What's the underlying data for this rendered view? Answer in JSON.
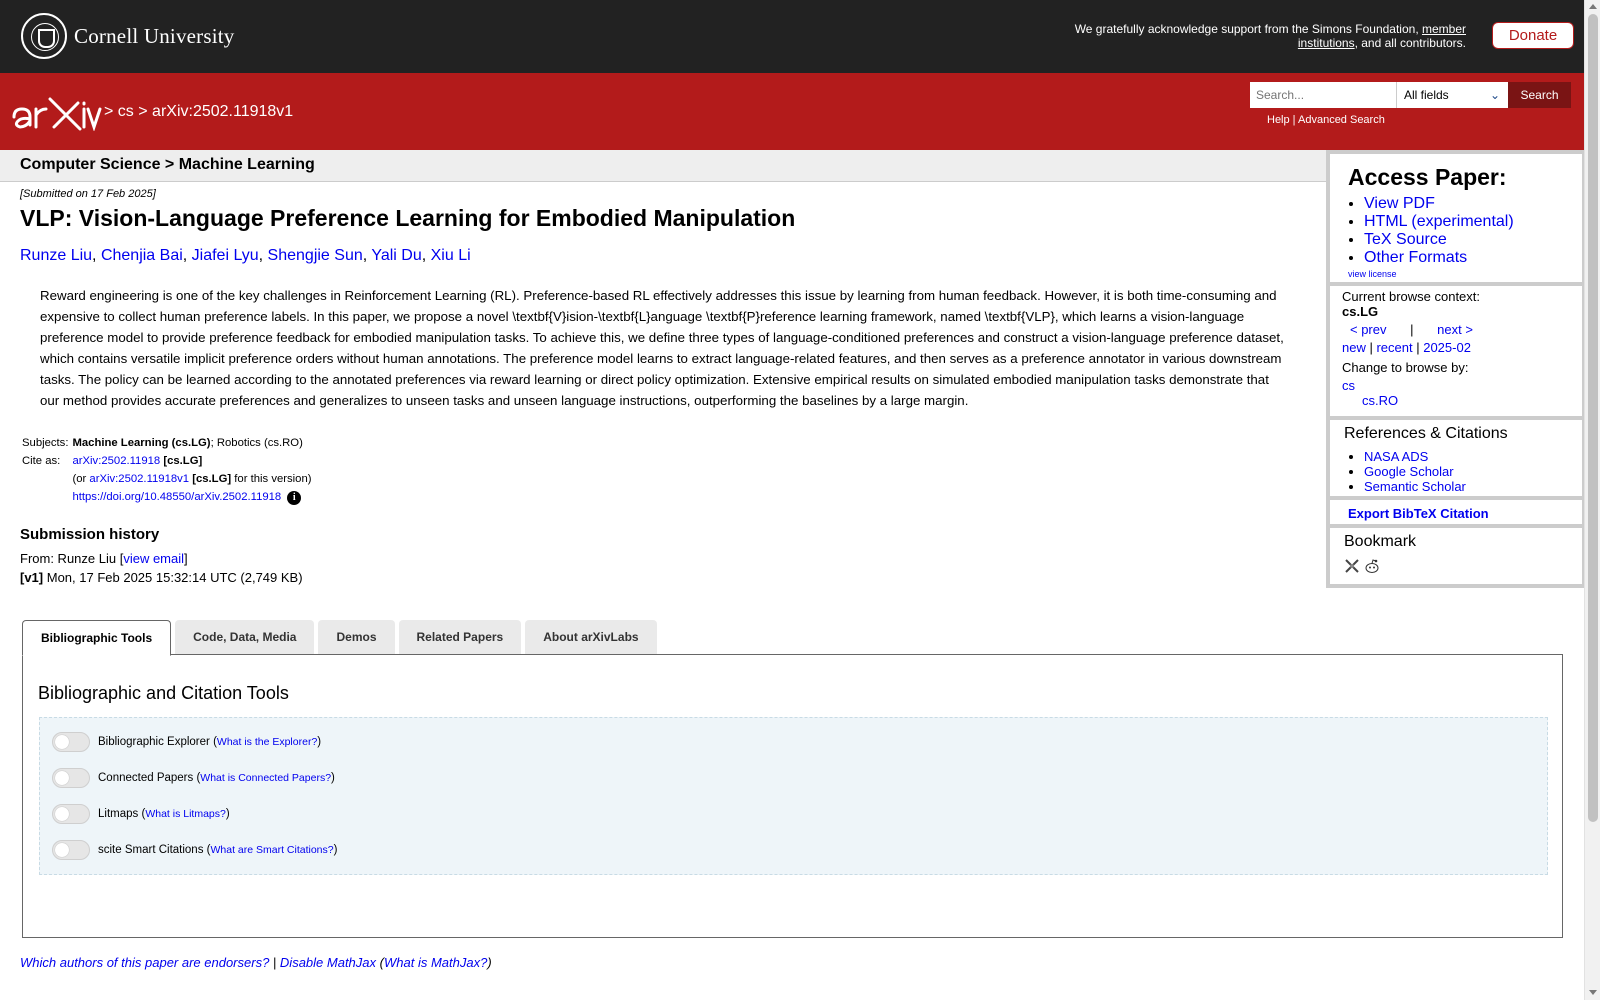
{
  "top": {
    "university": "Cornell University",
    "ack_text": "We gratefully acknowledge support from the Simons Foundation, ",
    "ack_link": "member institutions",
    "ack_tail": ", and all contributors.",
    "donate": "Donate"
  },
  "header": {
    "crumb_sep1": ">",
    "crumb_cs": "cs",
    "crumb_sep2": ">",
    "crumb_id": "arXiv:2502.11918v1",
    "search_placeholder": "Search...",
    "field_select": "All fields",
    "search_button": "Search",
    "help": "Help",
    "advanced": "Advanced Search"
  },
  "paper": {
    "subject_bar": "Computer Science > Machine Learning",
    "submitted": "[Submitted on 17 Feb 2025]",
    "title": "VLP: Vision-Language Preference Learning for Embodied Manipulation",
    "authors": [
      "Runze Liu",
      "Chenjia Bai",
      "Jiafei Lyu",
      "Shengjie Sun",
      "Yali Du",
      "Xiu Li"
    ],
    "abstract": "Reward engineering is one of the key challenges in Reinforcement Learning (RL). Preference-based RL effectively addresses this issue by learning from human feedback. However, it is both time-consuming and expensive to collect human preference labels. In this paper, we propose a novel \\textbf{V}ision-\\textbf{L}anguage \\textbf{P}reference learning framework, named \\textbf{VLP}, which learns a vision-language preference model to provide preference feedback for embodied manipulation tasks. To achieve this, we define three types of language-conditioned preferences and construct a vision-language preference dataset, which contains versatile implicit preference orders without human annotations. The preference model learns to extract language-related features, and then serves as a preference annotator in various downstream tasks. The policy can be learned according to the annotated preferences via reward learning or direct policy optimization. Extensive empirical results on simulated embodied manipulation tasks demonstrate that our method provides accurate preferences and generalizes to unseen tasks and unseen language instructions, outperforming the baselines by a large margin."
  },
  "meta": {
    "subjects_label": "Subjects:",
    "subjects_primary": "Machine Learning (cs.LG)",
    "subjects_rest": "; Robotics (cs.RO)",
    "cite_label": "Cite as:",
    "cite_id": "arXiv:2502.11918",
    "cite_cat": "[cs.LG]",
    "cite_or": "(or ",
    "cite_vid": "arXiv:2502.11918v1",
    "cite_vcat": "[cs.LG]",
    "cite_forver": " for this version)",
    "doi": "https://doi.org/10.48550/arXiv.2502.11918"
  },
  "history": {
    "heading": "Submission history",
    "from_text": "From: Runze Liu [",
    "from_link": "view email",
    "from_close": "]",
    "v1_label": "[v1]",
    "v1_text": " Mon, 17 Feb 2025 15:32:14 UTC (2,749 KB)"
  },
  "sidebar": {
    "access_heading": "Access Paper:",
    "access_links": [
      "View PDF",
      "HTML (experimental)",
      "TeX Source",
      "Other Formats"
    ],
    "view_license": "view license",
    "browse_context_label": "Current browse context:",
    "browse_context": "cs.LG",
    "prev": "< prev",
    "pipe": "|",
    "next": "next >",
    "new": "new",
    "recent": "recent",
    "month": "2025-02",
    "change_label": "Change to browse by:",
    "browse_cs": "cs",
    "browse_ro": "cs.RO",
    "refs_heading": "References & Citations",
    "refs": [
      "NASA ADS",
      "Google Scholar",
      "Semantic Scholar"
    ],
    "export": "Export BibTeX Citation",
    "bookmark_heading": "Bookmark"
  },
  "tabs": [
    "Bibliographic Tools",
    "Code, Data, Media",
    "Demos",
    "Related Papers",
    "About arXivLabs"
  ],
  "panel": {
    "heading": "Bibliographic and Citation Tools",
    "tools": [
      {
        "label": "Bibliographic Explorer",
        "link": "What is the Explorer?"
      },
      {
        "label": "Connected Papers",
        "link": "What is Connected Papers?"
      },
      {
        "label": "Litmaps",
        "link": "What is Litmaps?"
      },
      {
        "label": "scite Smart Citations",
        "link": "What are Smart Citations?"
      }
    ]
  },
  "footer": {
    "endorsers": "Which authors of this paper are endorsers?",
    "sep": " | ",
    "mathjax": "Disable MathJax",
    "whatis_open": " (",
    "whatis": "What is MathJax?",
    "whatis_close": ")"
  },
  "colors": {
    "brand_red": "#b31b1b",
    "topbar": "#222222",
    "link": "#0000ee"
  }
}
